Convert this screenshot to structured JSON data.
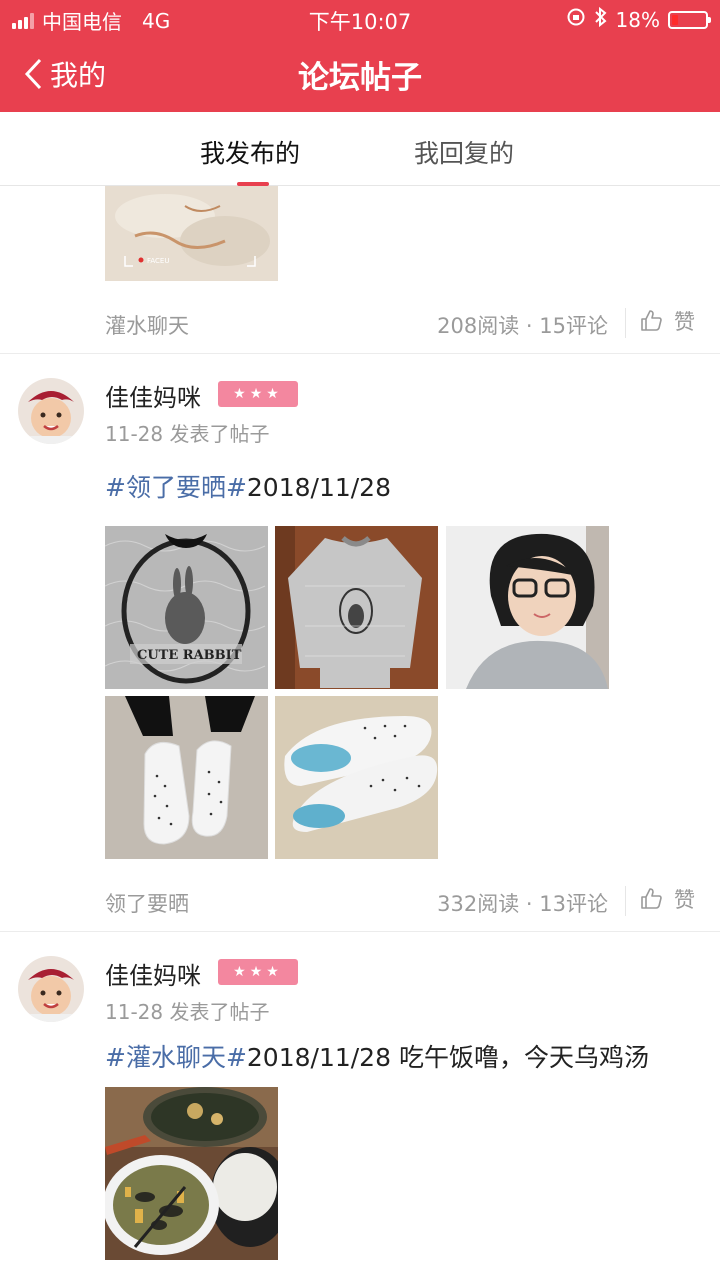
{
  "status": {
    "carrier": "中国电信",
    "network": "4G",
    "time": "下午10:07",
    "battery": "18%"
  },
  "nav": {
    "back_label": "我的",
    "title": "论坛帖子"
  },
  "tabs": [
    {
      "label": "我发布的",
      "active": true
    },
    {
      "label": "我回复的",
      "active": false
    }
  ],
  "posts": [
    {
      "image_caption": "FACEU",
      "category": "灌水聊天",
      "stats": "208阅读 · 15评论",
      "like_label": "赞"
    },
    {
      "author": "佳佳妈咪",
      "badge": "★★★",
      "time": "11-28 发表了帖子",
      "tag": "#领了要晒#",
      "text": "2018/11/28",
      "images": [
        "lace-rabbit-fabric",
        "grey-lace-shirt",
        "girl-glasses",
        "white-shoes-worn",
        "white-shoes-pair"
      ],
      "category": "领了要晒",
      "stats": "332阅读 · 13评论",
      "like_label": "赞"
    },
    {
      "author": "佳佳妈咪",
      "badge": "★★★",
      "time": "11-28 发表了帖子",
      "tag": "#灌水聊天#",
      "text": "2018/11/28  吃午饭噜，今天乌鸡汤",
      "images": [
        "chicken-soup-lunch"
      ]
    }
  ],
  "colors": {
    "brand": "#e8404f",
    "tag": "#4a6da7",
    "badge": "#f3879f"
  }
}
